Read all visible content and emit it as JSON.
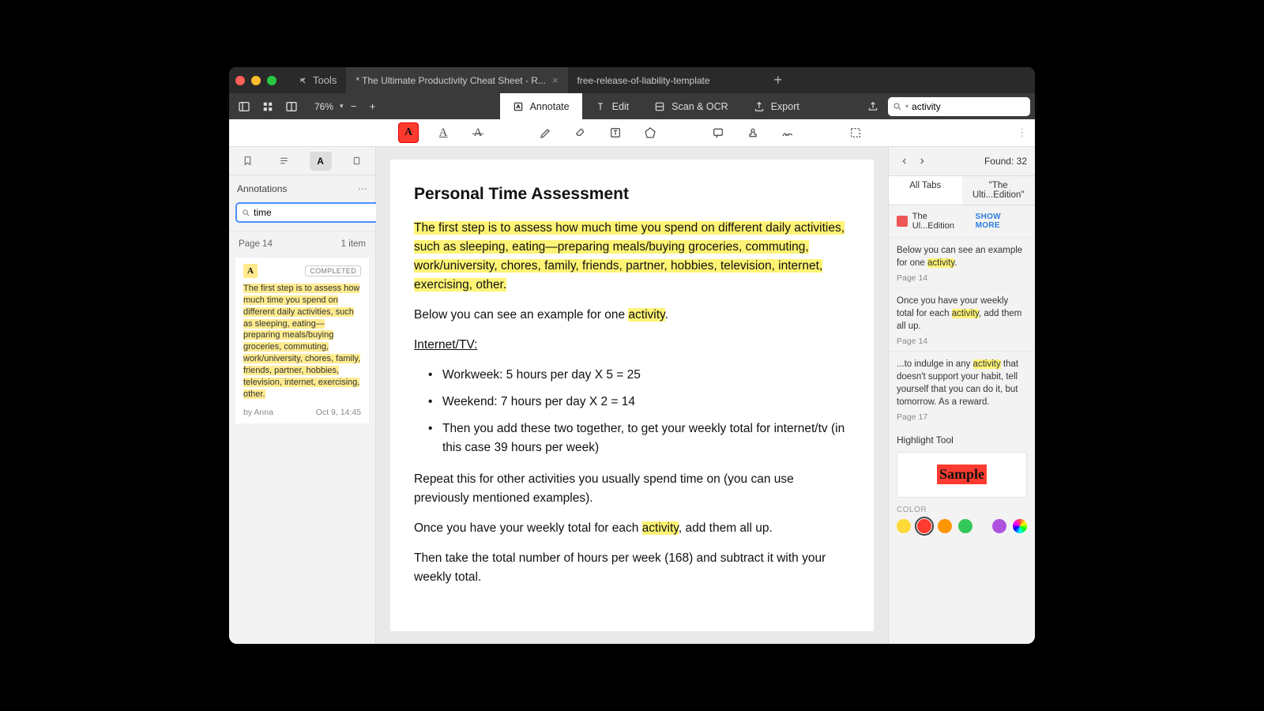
{
  "titlebar": {
    "tools_label": "Tools",
    "tabs": [
      {
        "label": "* The Ultimate Productivity Cheat Sheet - R...",
        "active": true,
        "closable": true
      },
      {
        "label": "free-release-of-liability-template",
        "active": false,
        "closable": false
      }
    ]
  },
  "toolbar": {
    "zoom": "76%",
    "modes": [
      {
        "label": "Annotate",
        "active": true
      },
      {
        "label": "Edit",
        "active": false
      },
      {
        "label": "Scan & OCR",
        "active": false
      },
      {
        "label": "Export",
        "active": false
      }
    ],
    "search_value": "activity"
  },
  "left": {
    "title": "Annotations",
    "search_value": "time",
    "page_label": "Page 14",
    "item_count": "1 item",
    "annotation": {
      "badge": "A",
      "status": "COMPLETED",
      "text": "The first step is to assess how much time you spend on different daily activities, such as sleeping, eating—preparing meals/buying groceries, commuting, work/university, chores, family, friends, partner, hobbies, television, internet, exercising, other.",
      "author": "by Anna",
      "date": "Oct 9, 14:45"
    }
  },
  "doc": {
    "heading": "Personal Time Assessment",
    "p1": "The first step is to assess how much time you spend on different daily activities, such as sleeping, eating—preparing meals/buying groceries, commuting, work/university, chores, family, friends, partner, hobbies, television, internet, exercising, other.",
    "p2a": "Below you can see an example for one ",
    "p2b": "activity",
    "p2c": ".",
    "sub": "Internet/TV:",
    "li1": "Workweek: 5 hours per day X 5 = 25",
    "li2": "Weekend: 7 hours per day X 2 = 14",
    "li3": "Then you add these two together, to get your weekly total for internet/tv (in this case 39 hours per week)",
    "p3": "Repeat this for other activities you usually spend time on (you can use previously mentioned examples).",
    "p4a": "Once you have your weekly total for each ",
    "p4b": "activity",
    "p4c": ", add them all up.",
    "p5": "Then take the total number of hours per week (168) and subtract it with your weekly total."
  },
  "right": {
    "found": "Found: 32",
    "tabs": [
      {
        "label": "All Tabs",
        "active": true
      },
      {
        "label": "\"The Ulti...Edition\"",
        "active": false
      }
    ],
    "source_label": "The Ul...Edition",
    "show_more": "SHOW MORE",
    "results": [
      {
        "pre": "Below you can see an example for one ",
        "match": "activity",
        "post": ".",
        "page": "Page 14"
      },
      {
        "pre": "Once you have your weekly total for each ",
        "match": "activity",
        "post": ", add them all up.",
        "page": "Page 14"
      },
      {
        "pre": "...to indulge in any ",
        "match": "activity",
        "post": " that doesn't support your habit, tell yourself that you can do it, but tomorrow. As a reward.",
        "page": "Page 17"
      }
    ],
    "highlight_tool_title": "Highlight Tool",
    "sample_text": "Sample",
    "color_label": "COLOR",
    "colors": [
      "#ffd938",
      "#ff3b30",
      "#ff9500",
      "#34c759",
      "#af52de"
    ]
  }
}
